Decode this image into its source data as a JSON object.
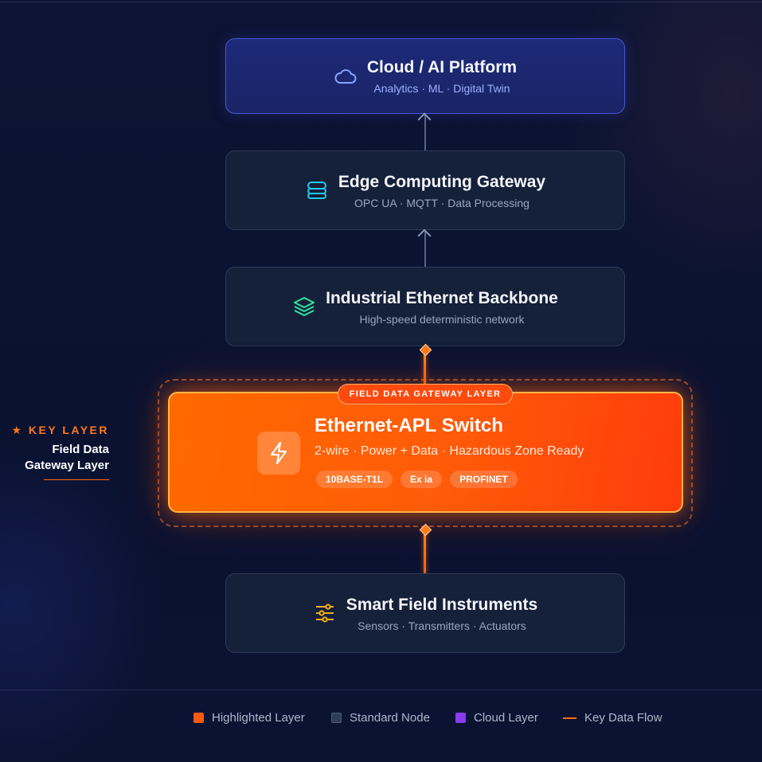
{
  "nodes": {
    "cloud": {
      "title": "Cloud / AI Platform",
      "subtitle": "Analytics · ML · Digital Twin",
      "icon": "cloud-icon"
    },
    "edge": {
      "title": "Edge Computing Gateway",
      "subtitle": "OPC UA · MQTT · Data Processing",
      "icon": "database-icon"
    },
    "backbone": {
      "title": "Industrial Ethernet Backbone",
      "subtitle": "High-speed deterministic network",
      "icon": "layers-icon"
    },
    "apl": {
      "tag": "FIELD DATA GATEWAY LAYER",
      "title": "Ethernet-APL Switch",
      "subtitle": "2-wire · Power + Data · Hazardous Zone Ready",
      "icon": "lightning-icon",
      "badges": [
        "10BASE-T1L",
        "Ex ia",
        "PROFINET"
      ]
    },
    "field": {
      "title": "Smart Field Instruments",
      "subtitle": "Sensors · Transmitters · Actuators",
      "icon": "sliders-icon"
    }
  },
  "key_layer": {
    "label": "★ KEY LAYER",
    "line1": "Field Data",
    "line2": "Gateway Layer"
  },
  "legend": {
    "highlighted": {
      "label": "Highlighted Layer",
      "color": "#ff5a10"
    },
    "standard": {
      "label": "Standard Node",
      "color": "#2f3d58"
    },
    "cloud": {
      "label": "Cloud Layer",
      "color": "#8a3cf0"
    },
    "flow": {
      "label": "Key Data Flow",
      "color": "#ff6a10"
    }
  }
}
